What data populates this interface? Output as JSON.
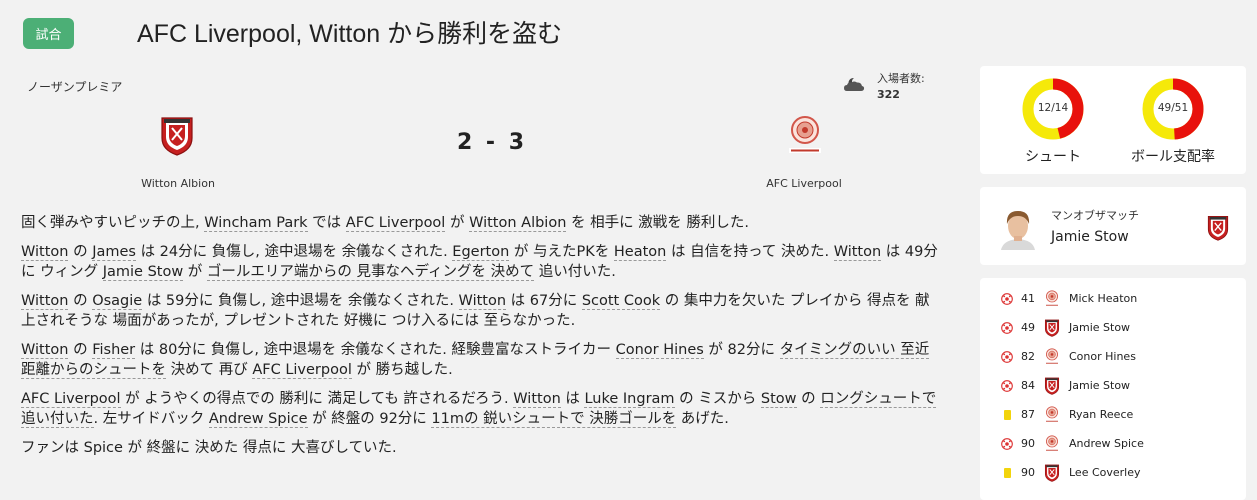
{
  "header": {
    "badge": "試合",
    "title": "AFC Liverpool, Witton から勝利を盗む"
  },
  "match": {
    "league": "ノーザンプレミア",
    "attendance_label": "入場者数:",
    "attendance_value": "322",
    "weather_icon": "cloudy-night-icon",
    "home_team": "Witton Albion",
    "away_team": "AFC Liverpool",
    "score": "2 - 3"
  },
  "report": [
    [
      {
        "t": "固く弾みやすいピッチの上, "
      },
      {
        "t": "Wincham Park",
        "u": true
      },
      {
        "t": " では "
      },
      {
        "t": "AFC Liverpool",
        "u": true
      },
      {
        "t": " が "
      },
      {
        "t": "Witton Albion",
        "u": true
      },
      {
        "t": " を 相手に 激戦を 勝利した."
      }
    ],
    [
      {
        "t": "Witton",
        "u": true
      },
      {
        "t": " の "
      },
      {
        "t": "James",
        "u": true
      },
      {
        "t": " は 24分に 負傷し, 途中退場を 余儀なくされた. "
      },
      {
        "t": "Egerton",
        "u": true
      },
      {
        "t": " が 与えたPKを "
      },
      {
        "t": "Heaton",
        "u": true
      },
      {
        "t": " は 自信を持って 決めた. "
      },
      {
        "t": "Witton",
        "u": true
      },
      {
        "t": " は 49分に ウィング "
      },
      {
        "t": "Jamie Stow",
        "u": true
      },
      {
        "t": " が "
      },
      {
        "t": "ゴールエリア端からの 見事なヘディングを 決めて",
        "u": true
      },
      {
        "t": " 追い付いた."
      }
    ],
    [
      {
        "t": "Witton",
        "u": true
      },
      {
        "t": " の "
      },
      {
        "t": "Osagie",
        "u": true
      },
      {
        "t": " は 59分に 負傷し, 途中退場を 余儀なくされた. "
      },
      {
        "t": "Witton",
        "u": true
      },
      {
        "t": " は 67分に "
      },
      {
        "t": "Scott Cook",
        "u": true
      },
      {
        "t": " の 集中力を欠いた プレイから 得点を 献上されそうな 場面があったが, プレゼントされた 好機に つけ入るには 至らなかった."
      }
    ],
    [
      {
        "t": "Witton",
        "u": true
      },
      {
        "t": " の "
      },
      {
        "t": "Fisher",
        "u": true
      },
      {
        "t": " は 80分に 負傷し, 途中退場を 余儀なくされた. 経験豊富なストライカー "
      },
      {
        "t": "Conor Hines",
        "u": true
      },
      {
        "t": " が 82分に "
      },
      {
        "t": "タイミングのいい 至近距離からのシュートを",
        "u": true
      },
      {
        "t": " 決めて 再び "
      },
      {
        "t": "AFC Liverpool",
        "u": true
      },
      {
        "t": " が 勝ち越した."
      }
    ],
    [
      {
        "t": "AFC Liverpool",
        "u": true
      },
      {
        "t": " が ようやくの得点での 勝利に 満足しても 許されるだろう. "
      },
      {
        "t": "Witton",
        "u": true
      },
      {
        "t": " は "
      },
      {
        "t": "Luke Ingram",
        "u": true
      },
      {
        "t": " の ミスから "
      },
      {
        "t": "Stow",
        "u": true
      },
      {
        "t": " の "
      },
      {
        "t": "ロングシュートで 追い付いた",
        "u": true
      },
      {
        "t": ". 左サイドバック "
      },
      {
        "t": "Andrew Spice",
        "u": true
      },
      {
        "t": " が 終盤の 92分に "
      },
      {
        "t": "11mの 鋭いシュートで 決勝ゴールを",
        "u": true
      },
      {
        "t": " あげた."
      }
    ],
    [
      {
        "t": "ファンは "
      },
      {
        "t": "Spice"
      },
      {
        "t": " が 終盤に 決めた 得点に 大喜びしていた."
      }
    ]
  ],
  "stats": {
    "shots": {
      "label": "シュート",
      "value_text": "12/14",
      "home": 12,
      "away": 14
    },
    "possession": {
      "label": "ボール支配率",
      "value_text": "49/51",
      "home": 49,
      "away": 51
    },
    "colors": {
      "home": "#e8120c",
      "away": "#f5e90a"
    }
  },
  "motm": {
    "label": "マンオブザマッチ",
    "name": "Jamie Stow"
  },
  "events": [
    {
      "icon": "goal-icon",
      "minute": "41",
      "team": "away",
      "player": "Mick Heaton"
    },
    {
      "icon": "goal-icon",
      "minute": "49",
      "team": "home",
      "player": "Jamie Stow"
    },
    {
      "icon": "goal-icon",
      "minute": "82",
      "team": "away",
      "player": "Conor Hines"
    },
    {
      "icon": "goal-icon",
      "minute": "84",
      "team": "home",
      "player": "Jamie Stow"
    },
    {
      "icon": "yellow-card-icon",
      "minute": "87",
      "team": "away",
      "player": "Ryan Reece"
    },
    {
      "icon": "goal-icon",
      "minute": "90",
      "team": "away",
      "player": "Andrew Spice"
    },
    {
      "icon": "yellow-card-icon",
      "minute": "90",
      "team": "home",
      "player": "Lee Coverley"
    }
  ]
}
